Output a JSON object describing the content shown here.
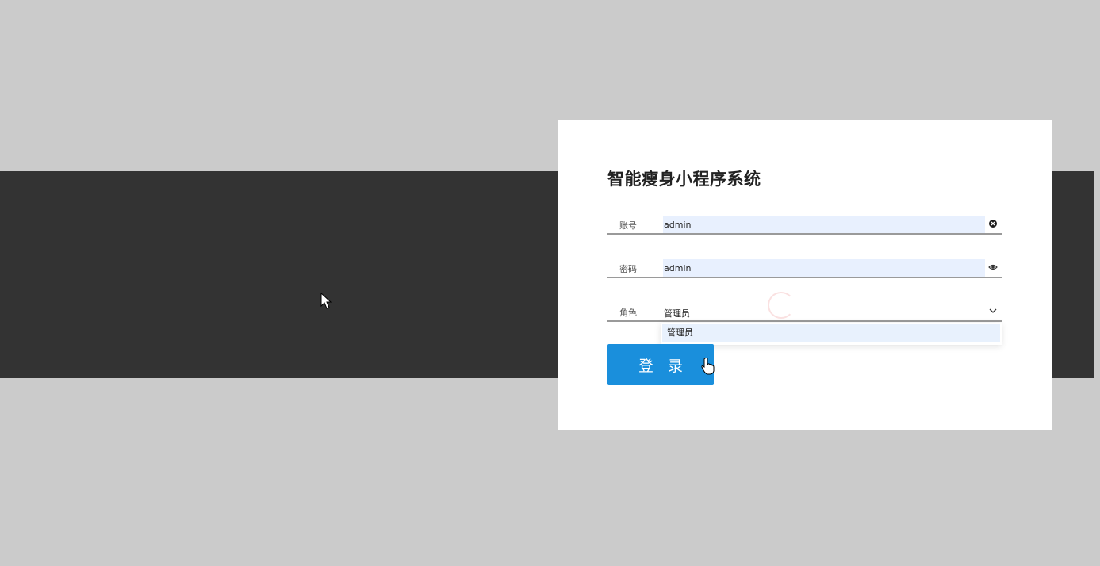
{
  "app": {
    "title": "智能瘦身小程序系统"
  },
  "form": {
    "account": {
      "label": "账号",
      "value": "admin"
    },
    "password": {
      "label": "密码",
      "value": "admin"
    },
    "role": {
      "label": "角色",
      "selected": "管理员",
      "options": [
        "管理员"
      ]
    },
    "login_label": "登 录"
  },
  "colors": {
    "page_bg": "#cbcbcb",
    "band": "#333333",
    "card": "#ffffff",
    "primary": "#1a8fdc",
    "autofill": "#e8f0fe"
  },
  "icons": {
    "account": "clear-icon",
    "password": "eye-icon",
    "role": "chevron-down-icon"
  }
}
